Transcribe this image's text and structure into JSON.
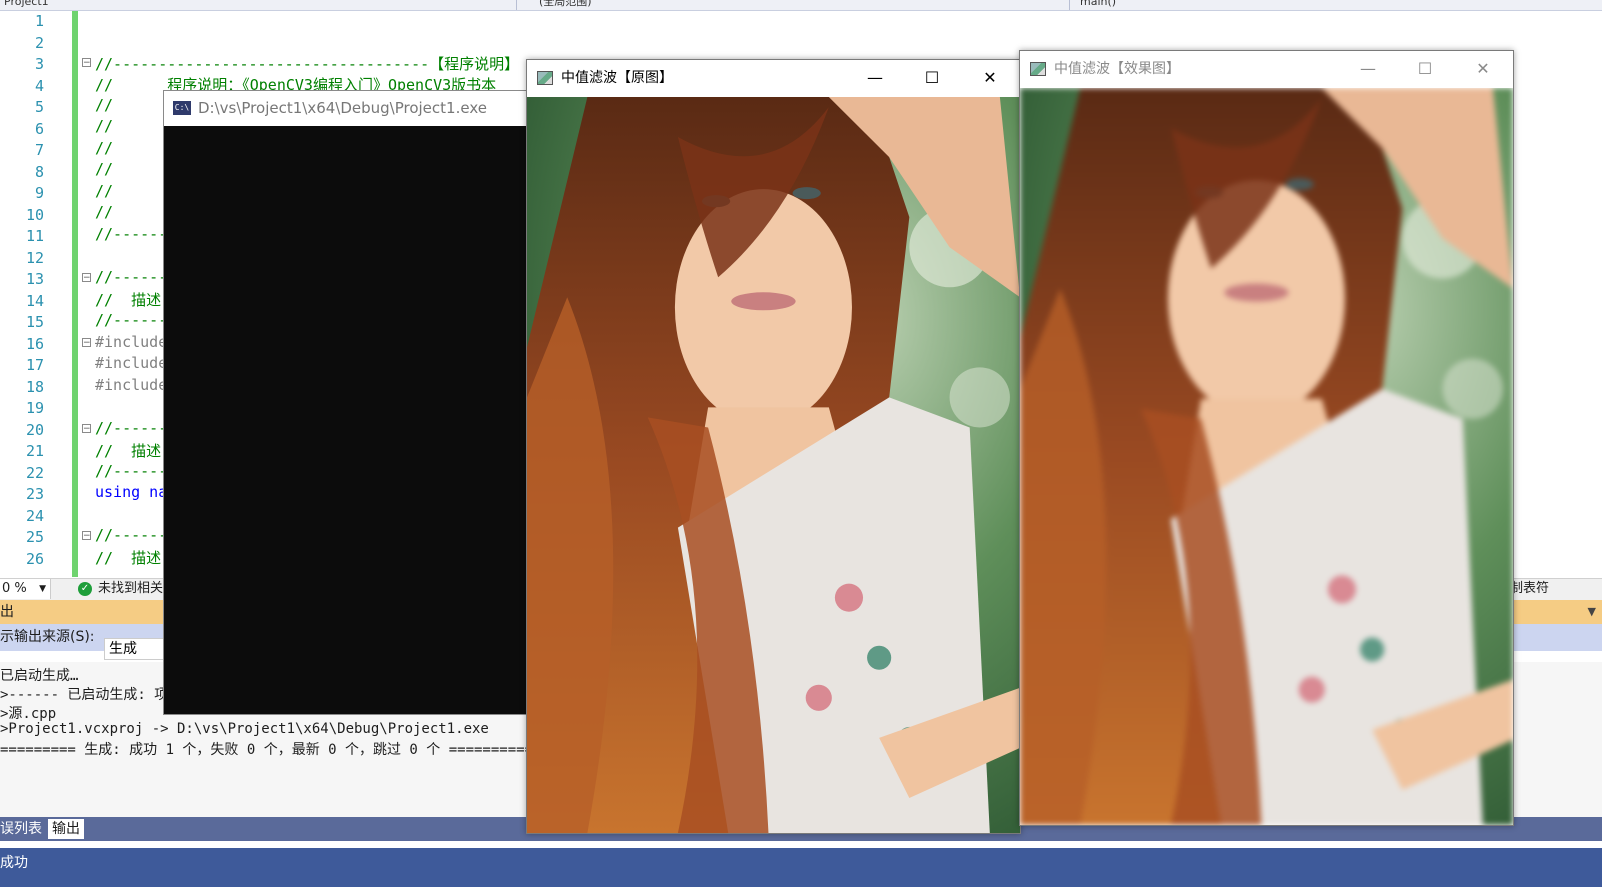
{
  "editor": {
    "nav": [
      "Project1",
      "(全局范围)",
      "main()"
    ],
    "line_numbers": [
      "1",
      "2",
      "3",
      "4",
      "5",
      "6",
      "7",
      "8",
      "9",
      "10",
      "11",
      "12",
      "13",
      "14",
      "15",
      "16",
      "17",
      "18",
      "19",
      "20",
      "21",
      "22",
      "23",
      "24",
      "25",
      "26"
    ],
    "lines": {
      "l3": "//-----------------------------------【程序说明】",
      "l4": "//      程序说明：《OpenCV3编程入门》OpenCV3版书本",
      "l5": "//",
      "l6": "//",
      "l7": "//",
      "l8": "//",
      "l9": "//",
      "l10": "//",
      "l11": "//------",
      "l13": "//------",
      "l14": "//  描述",
      "l15": "//------",
      "l16": "#include",
      "l17": "#include",
      "l18": "#include",
      "l20": "//------",
      "l21": "//  描述",
      "l22": "//------",
      "l23_kw": "using",
      "l23_rest": " na",
      "l25": "//------",
      "l26": "//  描述"
    }
  },
  "statusbar": {
    "zoom": "0 %",
    "issues": "未找到相关",
    "right_text": "制表符"
  },
  "output": {
    "header": "出",
    "source_label": "示输出来源(S):",
    "source_value": "生成",
    "lines": [
      "已启动生成…",
      ">------ 已启动生成: 项",
      ">源.cpp",
      ">Project1.vcxproj -> D:\\vs\\Project1\\x64\\Debug\\Project1.exe",
      "========= 生成: 成功 1 个，失败 0 个，最新 0 个，跳过 0 个 =========="
    ]
  },
  "bottom_tabs": [
    "误列表",
    "输出"
  ],
  "vs_status": "成功",
  "console": {
    "icon": "C:\\",
    "title": "D:\\vs\\Project1\\x64\\Debug\\Project1.exe"
  },
  "window_original": {
    "title": "中值滤波【原图】",
    "minimize": "—",
    "maximize": "☐",
    "close": "✕"
  },
  "window_effect": {
    "title": "中值滤波【效果图】",
    "minimize": "—",
    "maximize": "☐",
    "close": "✕"
  },
  "colors": {
    "line_number": "#2b91af",
    "comment": "#008000",
    "keyword": "#0000ff",
    "change_bar": "#6fd36f",
    "output_header": "#f5cc84",
    "vs_status_bar": "#3e5a9a"
  }
}
